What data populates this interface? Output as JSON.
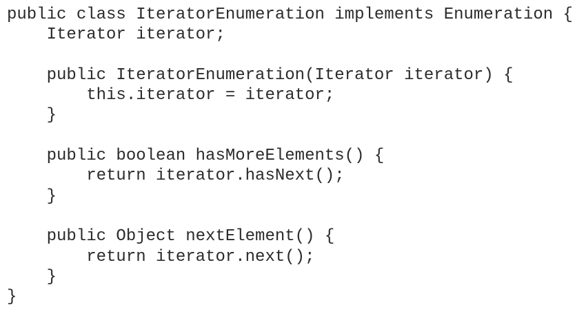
{
  "code": {
    "lines": [
      "public class IteratorEnumeration implements Enumeration {",
      "    Iterator iterator;",
      "",
      "    public IteratorEnumeration(Iterator iterator) {",
      "        this.iterator = iterator;",
      "    }",
      "",
      "    public boolean hasMoreElements() {",
      "        return iterator.hasNext();",
      "    }",
      "",
      "    public Object nextElement() {",
      "        return iterator.next();",
      "    }",
      "}"
    ]
  }
}
